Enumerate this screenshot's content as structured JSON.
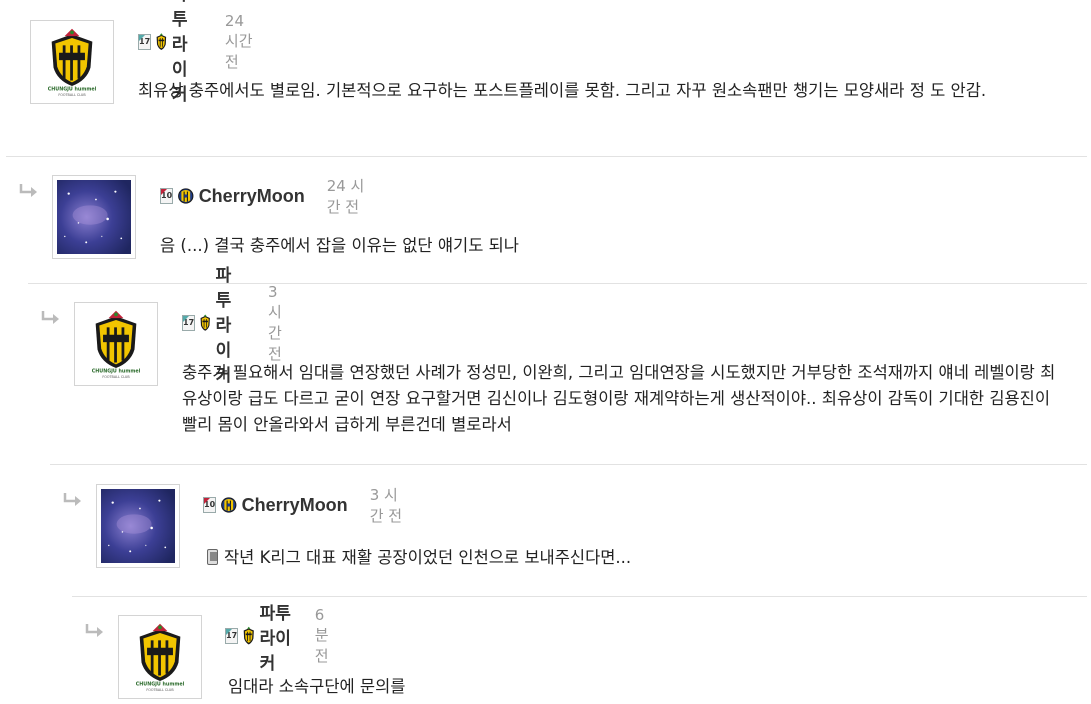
{
  "comments": [
    {
      "nick": "파투라이커",
      "level": "17",
      "time": "24 시간 전",
      "text": "최유상 충주에서도 별로임. 기본적으로 요구하는 포스트플레이를 못함. 그리고 자꾸 원소속팬만 챙기는 모양새라 정 도 안감.",
      "avatar": "chungju-humel-logo-icon",
      "emblem": "chungju-emblem-icon"
    },
    {
      "nick": "CherryMoon",
      "level": "10",
      "time": "24 시간 전",
      "text": "음 (...) 결국 충주에서 잡을 이유는 없단 얘기도 되나",
      "avatar": "galaxy-image-icon",
      "emblem": "incheon-united-emblem-icon"
    },
    {
      "nick": "파투라이커",
      "level": "17",
      "time": "3 시간 전",
      "text": "충주가 필요해서 임대를 연장했던 사례가 정성민, 이완희, 그리고 임대연장을 시도했지만 거부당한 조석재까지 얘네 레벨이랑 최유상이랑 급도 다르고 굳이 연장 요구할거면 김신이나 김도형이랑 재계약하는게 생산적이야.. 최유상이 감독이 기대한 김용진이 빨리 몸이 안올라와서 급하게 부른건데 별로라서",
      "avatar": "chungju-humel-logo-icon",
      "emblem": "chungju-emblem-icon"
    },
    {
      "nick": "CherryMoon",
      "level": "10",
      "time": "3 시간 전",
      "text": "작년 K리그 대표 재활 공장이었던 인천으로 보내주신다면...",
      "avatar": "galaxy-image-icon",
      "emblem": "incheon-united-emblem-icon",
      "mobile_icon": "mobile-phone-icon"
    },
    {
      "nick": "파투라이커",
      "level": "17",
      "time": "6 분 전",
      "text": "임대라 소속구단에 문의를",
      "avatar": "chungju-humel-logo-icon",
      "emblem": "chungju-emblem-icon"
    }
  ],
  "logo_text": {
    "name": "CHUNGJU hummel",
    "sub": "FOOTBALL CLUB"
  },
  "colors": {
    "accent_level_17": "#55aaaa",
    "accent_level_10": "#c0233a",
    "emblem_yellow": "#f2c500",
    "emblem_black": "#1a1a1a",
    "incheon_blue": "#1b3a8c"
  }
}
